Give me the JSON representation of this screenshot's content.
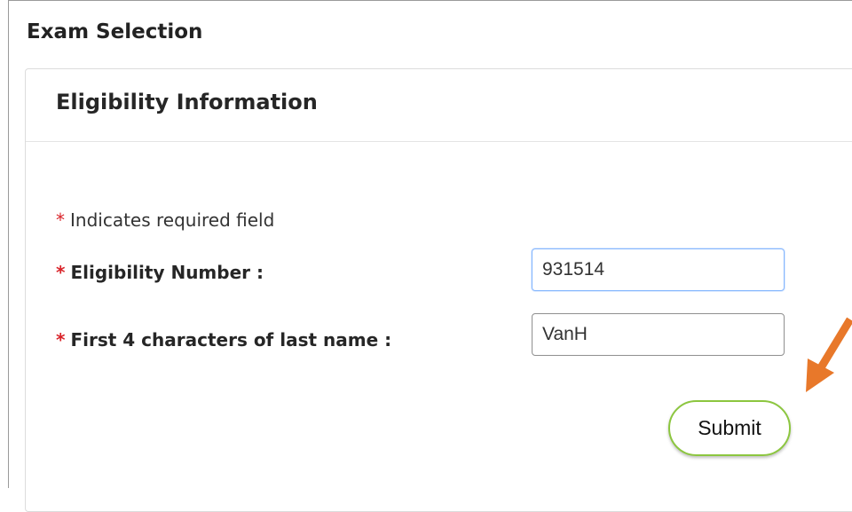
{
  "page": {
    "title": "Exam Selection"
  },
  "card": {
    "title": "Eligibility Information"
  },
  "form": {
    "required_marker": "*",
    "required_note": "Indicates required field",
    "eligibility_label": "Eligibility Number :",
    "eligibility_value": "931514",
    "lastname_label": "First 4 characters of last name :",
    "lastname_value": "VanH",
    "submit_label": "Submit"
  },
  "colors": {
    "required": "#d9242a",
    "submit_border": "#8cc63f",
    "arrow": "#e8782a",
    "focus_border": "#86b7fe"
  },
  "icons": {
    "annotation": "arrow-pointer-icon"
  }
}
